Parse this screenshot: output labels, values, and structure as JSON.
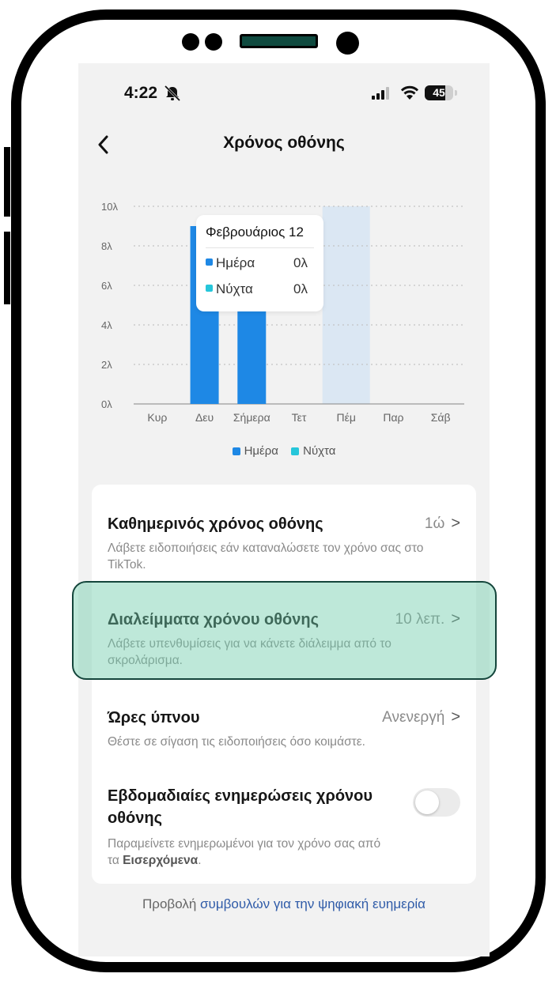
{
  "status_bar": {
    "time": "4:22",
    "battery": "45",
    "icons": [
      "bell-muted-icon",
      "signal-icon",
      "wifi-icon",
      "battery-icon"
    ]
  },
  "header": {
    "title": "Χρόνος οθόνης",
    "back_icon": "chevron-left-icon"
  },
  "chart_data": {
    "type": "bar",
    "categories": [
      "Κυρ",
      "Δευ",
      "Σήμερα",
      "Τετ",
      "Πέμ",
      "Παρ",
      "Σάβ"
    ],
    "y_ticks": [
      "0λ",
      "2λ",
      "4λ",
      "6λ",
      "8λ",
      "10λ"
    ],
    "ylim": [
      0,
      10
    ],
    "grid": true,
    "selected_category": "Πέμ",
    "series": [
      {
        "name": "Ημέρα",
        "color": "#1e88e5",
        "values": [
          0,
          9,
          8,
          0,
          0,
          0,
          0
        ]
      },
      {
        "name": "Νύχτα",
        "color": "#26c6da",
        "values": [
          0,
          0,
          0,
          0,
          0,
          0,
          0
        ]
      }
    ],
    "legend_position": "bottom-center",
    "tooltip": {
      "title": "Φεβρουάριος 12",
      "rows": [
        {
          "label": "Ημέρα",
          "value": "0λ",
          "color": "#1e88e5"
        },
        {
          "label": "Νύχτα",
          "value": "0λ",
          "color": "#26c6da"
        }
      ]
    }
  },
  "settings": {
    "daily": {
      "title": "Καθημερινός χρόνος οθόνης",
      "value": "1ώ",
      "desc": "Λάβετε ειδοποιήσεις εάν καταναλώσετε τον χρόνο σας στο TikTok."
    },
    "breaks": {
      "title": "Διαλείμματα χρόνου οθόνης",
      "value": "10 λεπ.",
      "desc": "Λάβετε υπενθυμίσεις για να κάνετε διάλειμμα από το σκρολάρισμα."
    },
    "sleep": {
      "title": "Ώρες ύπνου",
      "value": "Ανενεργή",
      "desc": "Θέστε σε σίγαση τις ειδοποιήσεις όσο κοιμάστε."
    },
    "weekly": {
      "title": "Εβδομαδιαίες ενημερώσεις χρόνου οθόνης",
      "desc_prefix": "Παραμείνετε ενημερωμένοι για τον χρόνο σας από τα ",
      "desc_bold": "Εισερχόμενα",
      "desc_suffix": ".",
      "toggle_on": false
    },
    "chevron": ">"
  },
  "footer": {
    "prefix": "Προβολή ",
    "link": "συμβουλών για την ψηφιακή ευημερία"
  },
  "colors": {
    "day": "#1e88e5",
    "night": "#26c6da",
    "highlight": "#6fcdaa",
    "link": "#2f5ba8"
  }
}
